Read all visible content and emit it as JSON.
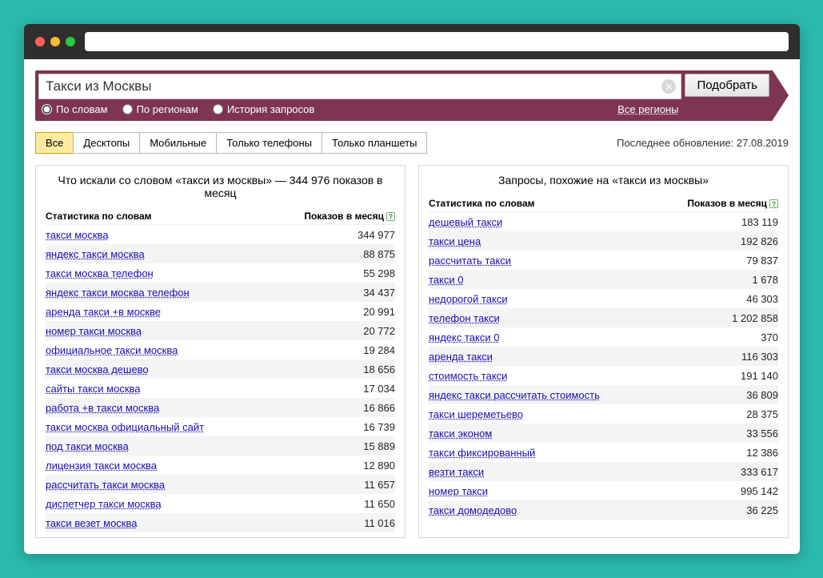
{
  "search": {
    "value": "Такси из Москвы",
    "submit": "Подобрать",
    "options": {
      "by_words": "По словам",
      "by_regions": "По регионам",
      "history": "История запросов"
    },
    "all_regions": "Все регионы"
  },
  "device_tabs": [
    "Все",
    "Десктопы",
    "Мобильные",
    "Только телефоны",
    "Только планшеты"
  ],
  "last_update_label": "Последнее обновление: 27.08.2019",
  "left_panel": {
    "title": "Что искали со словом «такси из москвы» — 344 976 показов в месяц",
    "col_word": "Статистика по словам",
    "col_count": "Показов в месяц",
    "rows": [
      {
        "kw": "такси москва",
        "cnt": "344 977"
      },
      {
        "kw": "яндекс такси москва",
        "cnt": "88 875"
      },
      {
        "kw": "такси москва телефон",
        "cnt": "55 298"
      },
      {
        "kw": "яндекс такси москва телефон",
        "cnt": "34 437"
      },
      {
        "kw": "аренда такси +в москве",
        "cnt": "20 991"
      },
      {
        "kw": "номер такси москва",
        "cnt": "20 772"
      },
      {
        "kw": "официальное такси москва",
        "cnt": "19 284"
      },
      {
        "kw": "такси москва дешево",
        "cnt": "18 656"
      },
      {
        "kw": "сайты такси москва",
        "cnt": "17 034"
      },
      {
        "kw": "работа +в такси москва",
        "cnt": "16 866"
      },
      {
        "kw": "такси москва официальный сайт",
        "cnt": "16 739"
      },
      {
        "kw": "под такси москва",
        "cnt": "15 889"
      },
      {
        "kw": "лицензия такси москва",
        "cnt": "12 890"
      },
      {
        "kw": "рассчитать такси москва",
        "cnt": "11 657"
      },
      {
        "kw": "диспетчер такси москва",
        "cnt": "11 650"
      },
      {
        "kw": "такси везет москва",
        "cnt": "11 016"
      }
    ]
  },
  "right_panel": {
    "title": "Запросы, похожие на «такси из москвы»",
    "col_word": "Статистика по словам",
    "col_count": "Показов в месяц",
    "rows": [
      {
        "kw": "дешевый такси",
        "cnt": "183 119"
      },
      {
        "kw": "такси цена",
        "cnt": "192 826"
      },
      {
        "kw": "рассчитать такси",
        "cnt": "79 837"
      },
      {
        "kw": "такси 0",
        "cnt": "1 678"
      },
      {
        "kw": "недорогой такси",
        "cnt": "46 303"
      },
      {
        "kw": "телефон такси",
        "cnt": "1 202 858"
      },
      {
        "kw": "яндекс такси 0",
        "cnt": "370"
      },
      {
        "kw": "аренда такси",
        "cnt": "116 303"
      },
      {
        "kw": "стоимость такси",
        "cnt": "191 140"
      },
      {
        "kw": "яндекс такси рассчитать стоимость",
        "cnt": "36 809"
      },
      {
        "kw": "такси шереметьево",
        "cnt": "28 375"
      },
      {
        "kw": "такси эконом",
        "cnt": "33 556"
      },
      {
        "kw": "такси фиксированный",
        "cnt": "12 386"
      },
      {
        "kw": "везти такси",
        "cnt": "333 617"
      },
      {
        "kw": "номер такси",
        "cnt": "995 142"
      },
      {
        "kw": "такси домодедово",
        "cnt": "36 225"
      }
    ]
  }
}
